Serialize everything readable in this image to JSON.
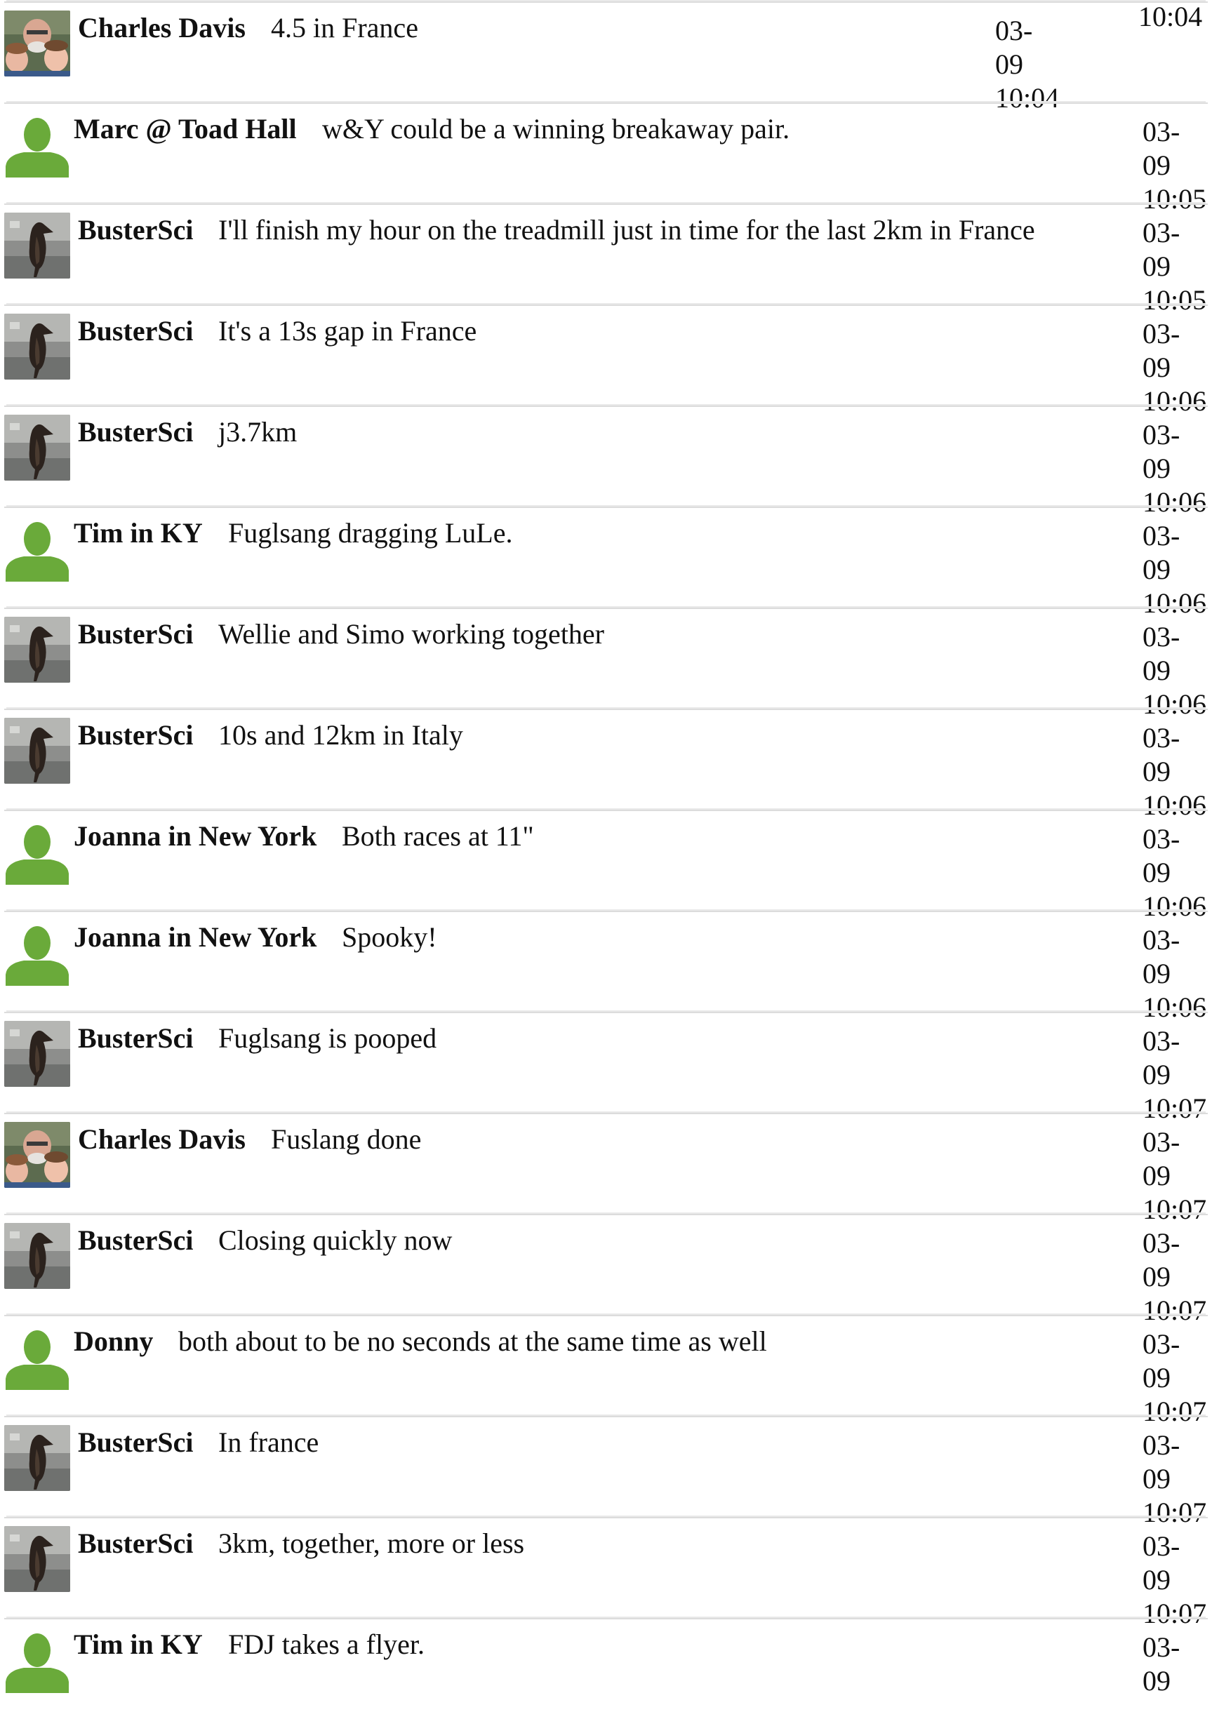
{
  "chat": {
    "leading_time": "10:04",
    "messages": [
      {
        "author": "Charles Davis",
        "text": "4.5 in France",
        "time": "03-\n09\n10:04",
        "avatar": "charles-photo"
      },
      {
        "author": "Marc @ Toad Hall",
        "text": "w&Y could be a winning breakaway pair.",
        "time": "03-\n09\n10:05",
        "avatar": "default-person"
      },
      {
        "author": "BusterSci",
        "text": "I'll finish my hour on the treadmill just in time for the last 2km in France",
        "time": "03-\n09\n10:05",
        "avatar": "penguin"
      },
      {
        "author": "BusterSci",
        "text": "It's a 13s gap in France",
        "time": "03-\n09\n10:06",
        "avatar": "penguin"
      },
      {
        "author": "BusterSci",
        "text": "j3.7km",
        "time": "03-\n09\n10:06",
        "avatar": "penguin"
      },
      {
        "author": "Tim in KY",
        "text": "Fuglsang dragging LuLe.",
        "time": "03-\n09\n10:06",
        "avatar": "default-person"
      },
      {
        "author": "BusterSci",
        "text": "Wellie and Simo working together",
        "time": "03-\n09\n10:06",
        "avatar": "penguin"
      },
      {
        "author": "BusterSci",
        "text": "10s and 12km in Italy",
        "time": "03-\n09\n10:06",
        "avatar": "penguin"
      },
      {
        "author": "Joanna in New York",
        "text": "Both races at 11\"",
        "time": "03-\n09\n10:06",
        "avatar": "default-person"
      },
      {
        "author": "Joanna in New York",
        "text": "Spooky!",
        "time": "03-\n09\n10:06",
        "avatar": "default-person"
      },
      {
        "author": "BusterSci",
        "text": "Fuglsang is pooped",
        "time": "03-\n09\n10:07",
        "avatar": "penguin"
      },
      {
        "author": "Charles Davis",
        "text": "Fuslang done",
        "time": "03-\n09\n10:07",
        "avatar": "charles-photo"
      },
      {
        "author": "BusterSci",
        "text": "Closing quickly now",
        "time": "03-\n09\n10:07",
        "avatar": "penguin"
      },
      {
        "author": "Donny",
        "text": "both about to be no seconds at the same time as well",
        "time": "03-\n09\n10:07",
        "avatar": "default-person"
      },
      {
        "author": "BusterSci",
        "text": "In france",
        "time": "03-\n09\n10:07",
        "avatar": "penguin"
      },
      {
        "author": "BusterSci",
        "text": "3km, together, more or less",
        "time": "03-\n09\n10:07",
        "avatar": "penguin"
      },
      {
        "author": "Tim in KY",
        "text": "FDJ takes a flyer.",
        "time": "03-\n09",
        "avatar": "default-person"
      }
    ]
  },
  "colors": {
    "default_avatar_green": "#6aaa3a",
    "divider": "#dcdcdc"
  }
}
